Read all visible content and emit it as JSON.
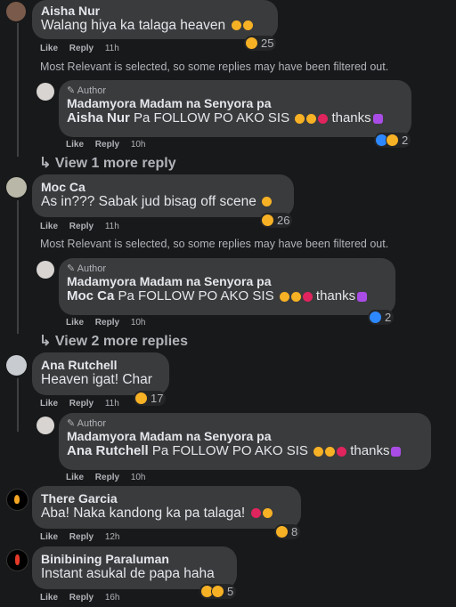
{
  "colors": {
    "bg": "#18191a",
    "bubble": "#3a3b3c",
    "text": "#e4e6eb",
    "muted": "#b0b3b8",
    "like_blue": "#2d88ff",
    "haha_yellow": "#f7b125"
  },
  "labels": {
    "like": "Like",
    "reply": "Reply"
  },
  "filter_note": "Most Relevant is selected, so some replies may have been filtered out.",
  "author_badge": "Author",
  "comments": [
    {
      "name": "Aisha Nur",
      "text": "Walang hiya ka talaga heaven",
      "time": "11h",
      "reactions": "25",
      "reply": {
        "name": "Madamyora Madam na Senyora pa",
        "mention": "Aisha Nur",
        "text": "Pa FOLLOW PO AKO SIS",
        "thanks": "thanks",
        "time": "10h",
        "reactions": "2"
      },
      "more_replies": "View 1 more reply"
    },
    {
      "name": "Moc Ca",
      "text": "As in??? Sabak jud bisag off scene",
      "time": "11h",
      "reactions": "26",
      "reply": {
        "name": "Madamyora Madam na Senyora pa",
        "mention": "Moc Ca",
        "text": "Pa FOLLOW PO AKO SIS",
        "thanks": "thanks",
        "time": "10h",
        "reactions": "2"
      },
      "more_replies": "View 2 more replies"
    },
    {
      "name": "Ana Rutchell",
      "text": "Heaven igat! Char",
      "time": "11h",
      "reactions": "17",
      "reply": {
        "name": "Madamyora Madam na Senyora pa",
        "mention": "Ana Rutchell",
        "text": "Pa FOLLOW PO AKO SIS",
        "thanks": "thanks",
        "time": "10h"
      }
    },
    {
      "name": "There Garcia",
      "text": "Aba! Naka kandong ka pa talaga!",
      "time": "12h",
      "reactions": "8"
    },
    {
      "name": "Binibining Paraluman",
      "text": "Instant asukal de papa haha",
      "time": "16h",
      "reactions": "5"
    }
  ]
}
